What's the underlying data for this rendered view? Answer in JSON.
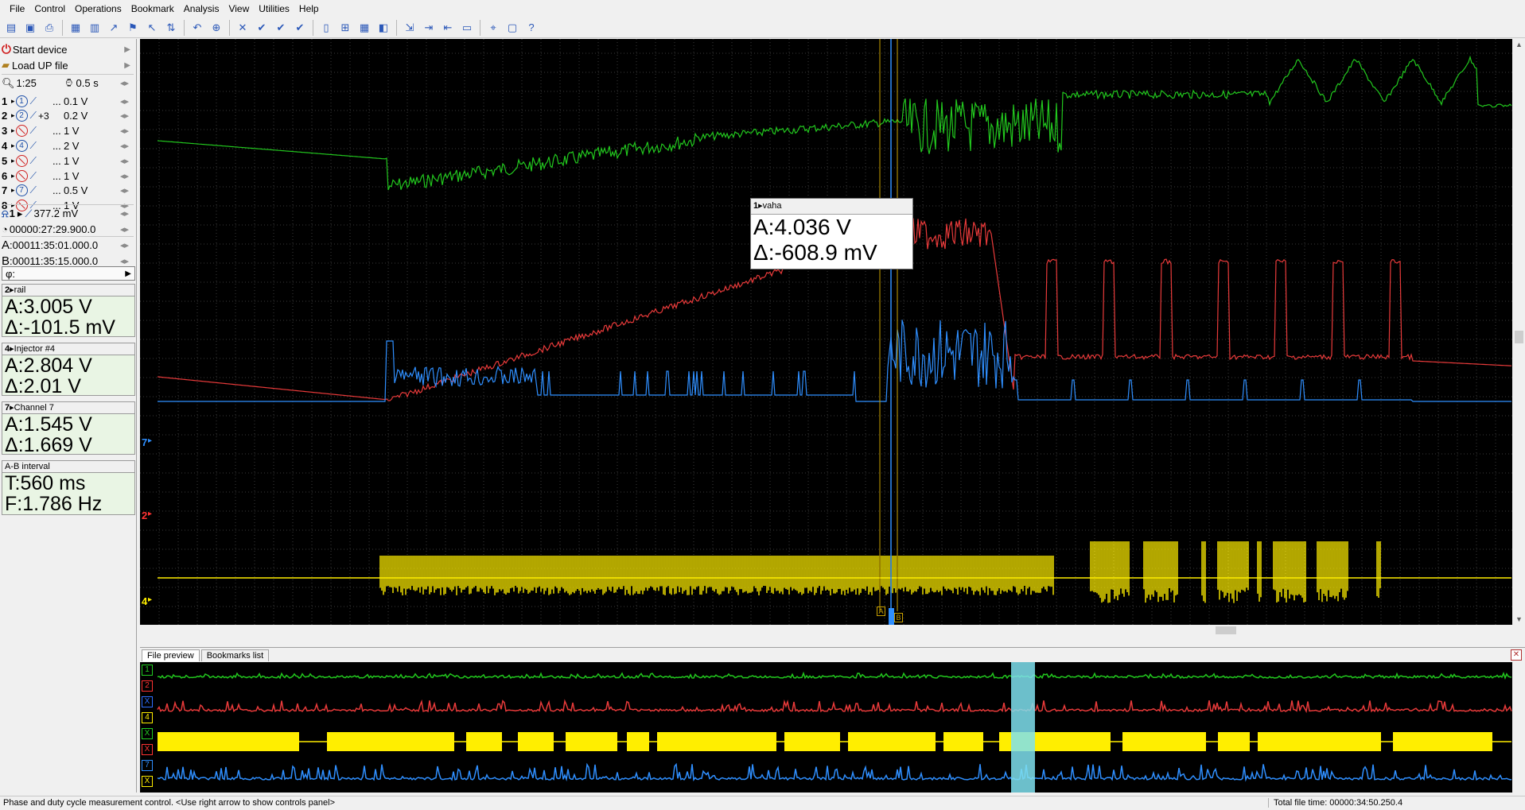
{
  "menu": [
    "File",
    "Control",
    "Operations",
    "Bookmark",
    "Analysis",
    "View",
    "Utilities",
    "Help"
  ],
  "toolbar_icons": [
    "open-icon",
    "save-icon",
    "print-icon",
    "device-icon",
    "channels-icon",
    "sweep-icon",
    "trigger-icon",
    "pointer-icon",
    "measure-icon",
    "undo-icon",
    "zoom-icon",
    "close-icon",
    "check-icon",
    "check-all-icon",
    "check-double-icon",
    "page-icon",
    "fit-icon",
    "grid-icon",
    "color-icon",
    "export-icon",
    "step-icon",
    "step-back-icon",
    "ruler-icon",
    "cursor-icon",
    "screen-icon",
    "help-icon"
  ],
  "left_panel": {
    "start_device": "Start device",
    "load_file": "Load UP file",
    "zoom": "1:25",
    "timebase": "0.5 s",
    "channels": [
      {
        "num": "1",
        "enabled": true,
        "offset": "",
        "scale": "0.1 V"
      },
      {
        "num": "2",
        "enabled": true,
        "offset": "+3",
        "scale": "0.2 V"
      },
      {
        "num": "3",
        "enabled": false,
        "offset": "",
        "scale": "1 V"
      },
      {
        "num": "4",
        "enabled": true,
        "offset": "",
        "scale": "2 V"
      },
      {
        "num": "5",
        "enabled": false,
        "offset": "",
        "scale": "1 V"
      },
      {
        "num": "6",
        "enabled": false,
        "offset": "",
        "scale": "1 V"
      },
      {
        "num": "7",
        "enabled": true,
        "offset": "",
        "scale": "0.5 V"
      },
      {
        "num": "8",
        "enabled": false,
        "offset": "",
        "scale": "1 V"
      }
    ],
    "trigger": {
      "channel": "1",
      "level": "377.2 mV"
    },
    "trigger_time": "00000:27:29.900.0",
    "cursor_a": "00011:35:01.000.0",
    "cursor_b": "00011:35:15.000.0",
    "phase_label": "φ:"
  },
  "measurements": [
    {
      "title": "rail",
      "ch": "2",
      "a": "A:3.005 V",
      "d": "Δ:-101.5 mV"
    },
    {
      "title": "Injector #4",
      "ch": "4",
      "a": "A:2.804 V",
      "d": "Δ:2.01 V"
    },
    {
      "title": "Channel 7",
      "ch": "7",
      "a": "A:1.545 V",
      "d": "Δ:1.669 V"
    }
  ],
  "ab_interval": {
    "title": "A-B interval",
    "t": "T:560 ms",
    "f": "F:1.786 Hz"
  },
  "tooltip": {
    "title": "vaha",
    "ch": "1",
    "a": "A:4.036 V",
    "d": "Δ:-608.9 mV"
  },
  "scope_markers": [
    {
      "label": "7",
      "color": "#2f8fff"
    },
    {
      "label": "2",
      "color": "#ff3333"
    },
    {
      "label": "4",
      "color": "#ffee00"
    }
  ],
  "cursor_labels": {
    "a": "A",
    "b": "B"
  },
  "preview": {
    "tabs": [
      "File preview",
      "Bookmarks list"
    ],
    "labels": [
      {
        "label": "1",
        "color": "#22cc22"
      },
      {
        "label": "2",
        "color": "#ff3333"
      },
      {
        "label": "X",
        "color": "#2f6fff"
      },
      {
        "label": "4",
        "color": "#ffee00"
      },
      {
        "label": "X",
        "color": "#22cc22"
      },
      {
        "label": "X",
        "color": "#ff3333"
      },
      {
        "label": "7",
        "color": "#2f8fff"
      },
      {
        "label": "X",
        "color": "#ffee00"
      }
    ]
  },
  "status": {
    "left": "Phase and duty cycle measurement control. <Use right arrow to show controls panel>",
    "right": "Total file time: 00000:34:50.250.4"
  },
  "colors": {
    "ch1": "#22c81e",
    "ch2": "#e83a3a",
    "ch4": "#ffee00",
    "ch7": "#2f8fff",
    "cursor_a": "#c8a000",
    "cursor_b": "#2f8fff"
  }
}
